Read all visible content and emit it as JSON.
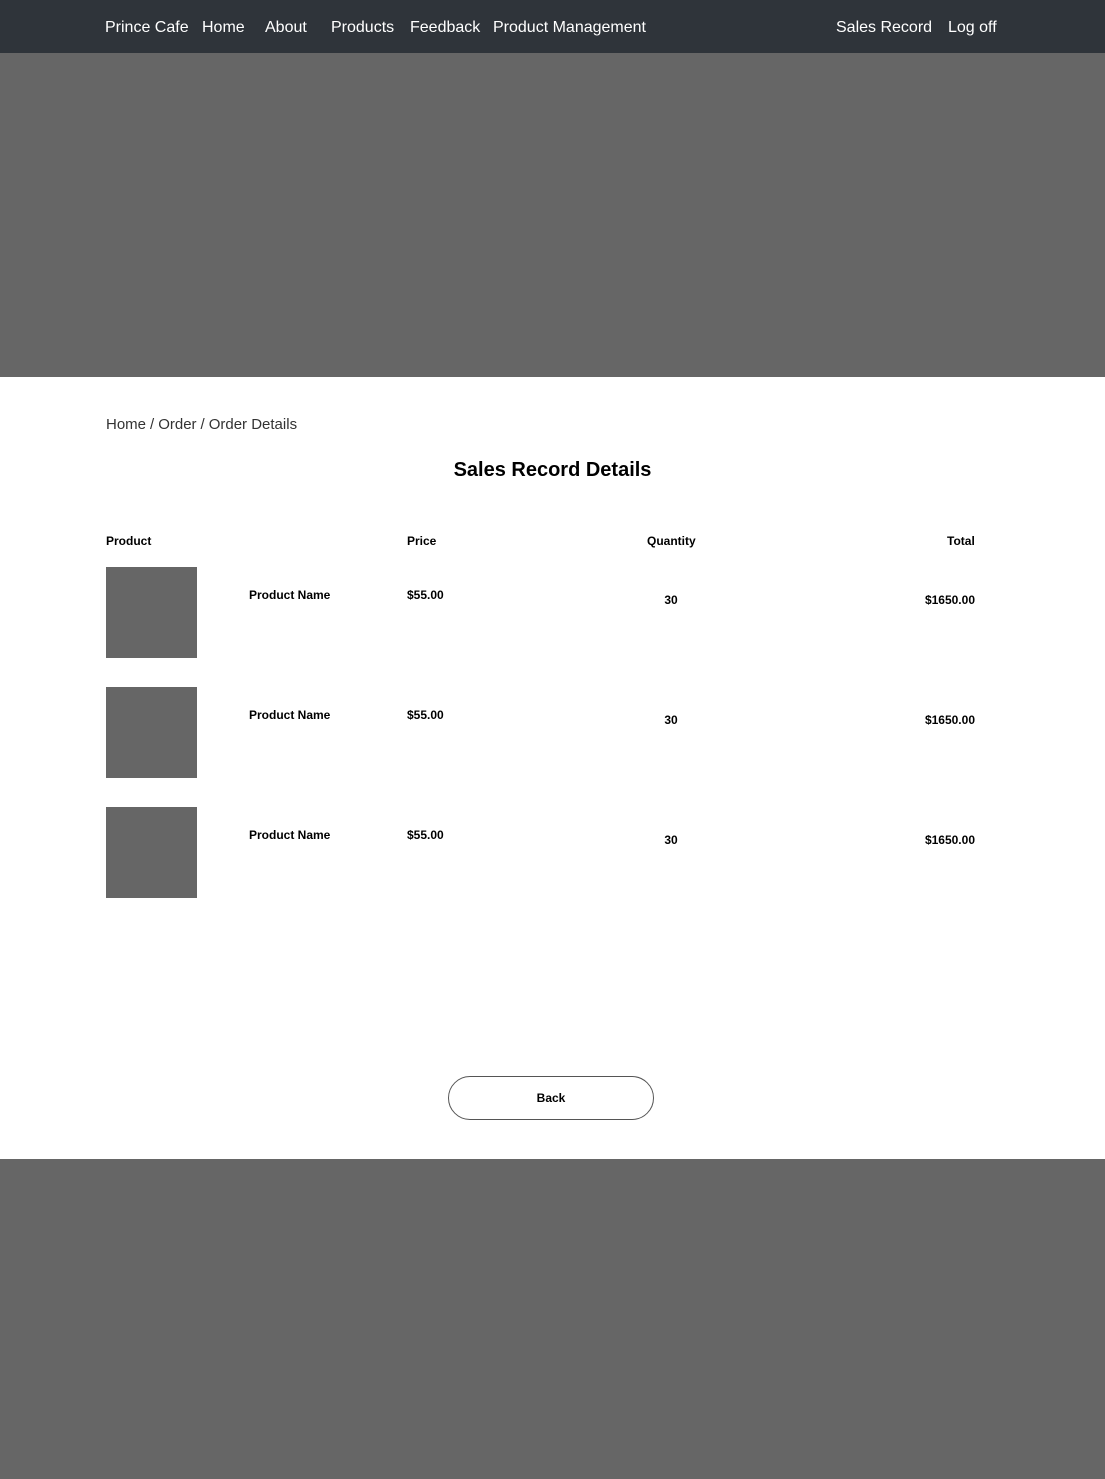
{
  "nav": {
    "brand": "Prince Cafe",
    "links": [
      "Home",
      "About",
      "Products",
      "Feedback",
      "Product Management"
    ],
    "right_links": [
      "Sales Record",
      "Log off"
    ]
  },
  "breadcrumb": [
    "Home",
    "Order",
    "Order Details"
  ],
  "breadcrumb_separator": "/",
  "page_title": "Sales Record Details",
  "table": {
    "headers": {
      "product": "Product",
      "price": "Price",
      "quantity": "Quantity",
      "total": "Total"
    },
    "rows": [
      {
        "name": "Product Name",
        "price": "$55.00",
        "quantity": "30",
        "total": "$1650.00"
      },
      {
        "name": "Product Name",
        "price": "$55.00",
        "quantity": "30",
        "total": "$1650.00"
      },
      {
        "name": "Product Name",
        "price": "$55.00",
        "quantity": "30",
        "total": "$1650.00"
      }
    ]
  },
  "back_label": "Back",
  "colors": {
    "navbar": "#2f343a",
    "placeholder": "#666666",
    "background": "#ffffff"
  }
}
